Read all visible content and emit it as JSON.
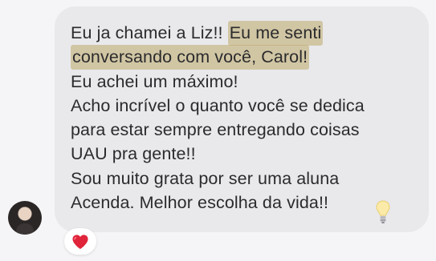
{
  "message": {
    "line1_plain": "Eu ja chamei a Liz!!",
    "line1_highlight": "Eu me senti",
    "line2_highlight": "conversando com você, Carol!",
    "line3": "Eu achei um máximo!",
    "line4": "Acho incrível o quanto você se dedica",
    "line5": "para estar sempre entregando coisas",
    "line6": "UAU pra gente!!",
    "line7": "Sou muito grata por ser uma aluna",
    "line8": "Acenda. Melhor escolha da vida!!"
  },
  "icons": {
    "trailing_emoji": "light-bulb-icon",
    "reaction": "red-heart-icon",
    "sender": "avatar"
  },
  "colors": {
    "bubble": "#e9e9ec",
    "highlight": "#beaa69",
    "heart": "#e0243a"
  }
}
